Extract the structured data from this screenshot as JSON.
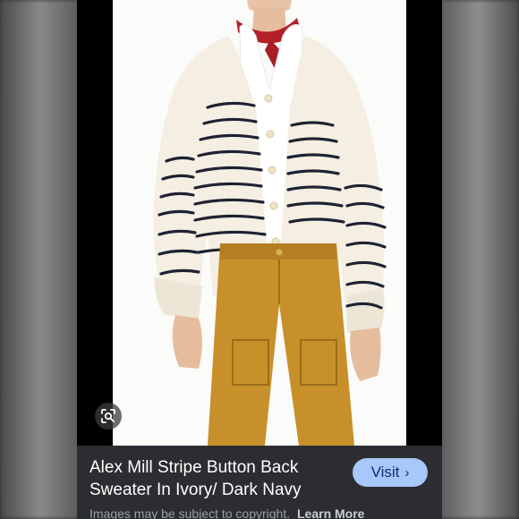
{
  "result_card": {
    "product_title": "Alex Mill Stripe Button Back Sweater In Ivory/ Dark Navy",
    "visit_label": "Visit",
    "visit_icon": "chevron-right-icon",
    "copyright_notice": "Images may be subject to copyright.",
    "learn_more_label": "Learn More",
    "lens_icon": "lens-search-icon"
  },
  "colors": {
    "info_bar_bg": "#2b2d31",
    "visit_button_bg": "#a8c7fa",
    "visit_button_text": "#0b2f6b",
    "title_text": "#ffffff",
    "muted_text": "#9aa0a6"
  }
}
